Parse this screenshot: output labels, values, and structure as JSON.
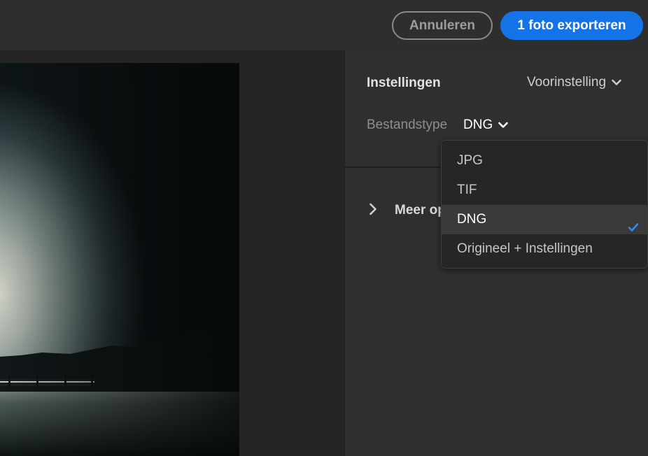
{
  "header": {
    "cancel_label": "Annuleren",
    "export_label": "1 foto exporteren"
  },
  "settings": {
    "title": "Instellingen",
    "preset_label": "Voorinstelling",
    "filetype_label": "Bestandstype",
    "filetype_value": "DNG",
    "more_options_label": "Meer op"
  },
  "dropdown": {
    "options": [
      {
        "label": "JPG",
        "selected": false
      },
      {
        "label": "TIF",
        "selected": false
      },
      {
        "label": "DNG",
        "selected": true
      },
      {
        "label": "Origineel + Instellingen",
        "selected": false
      }
    ]
  },
  "colors": {
    "accent": "#1473e6",
    "background": "#252525",
    "panel": "#2f2f2f"
  }
}
